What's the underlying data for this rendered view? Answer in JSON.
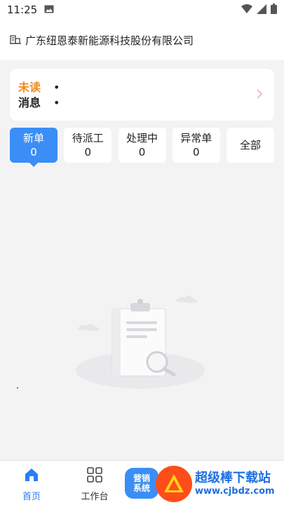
{
  "status_bar": {
    "time": "11:25"
  },
  "header": {
    "company_name": "广东纽恩泰新能源科技股份有限公司"
  },
  "messages": {
    "label_line1": "未读",
    "label_line2": "消息",
    "items": [
      "•",
      "•"
    ]
  },
  "tabs": [
    {
      "label": "新单",
      "count": "0"
    },
    {
      "label": "待派工",
      "count": "0"
    },
    {
      "label": "处理中",
      "count": "0"
    },
    {
      "label": "异常单",
      "count": "0"
    },
    {
      "label": "全部",
      "count": ""
    }
  ],
  "bottom_nav": {
    "home": "首页",
    "workbench": "工作台",
    "marketing_line1": "营销",
    "marketing_line2": "系统"
  },
  "watermark": {
    "title": "超级棒下载站",
    "url": "www.cjbdz.com"
  },
  "colors": {
    "accent": "#3a8ef6",
    "unread": "#f08a1d",
    "watermark": "#1d6fe0"
  }
}
